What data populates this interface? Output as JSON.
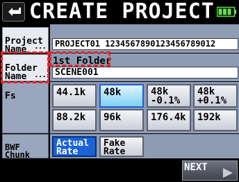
{
  "title": "CREATE PROJECT",
  "icons": {
    "back": "return-arrow-icon",
    "battery": "battery-full-icon",
    "next": "right-arrow-icon"
  },
  "project_name": {
    "label": "Project\nName",
    "dots": "...",
    "value": "PROJECT01 1234567890123456789012"
  },
  "folder_name": {
    "label": "Folder\nName",
    "dots": "...",
    "row_label": "1st Folder",
    "value": "SCENE001"
  },
  "fs": {
    "label": "Fs",
    "options": [
      "44.1k",
      "48k",
      "48k\n-0.1%",
      "48k\n+0.1%",
      "88.2k",
      "96k",
      "176.4k",
      "192k"
    ],
    "selected": "48k"
  },
  "bwf": {
    "label": "BWF\nChunk\nFs",
    "options": [
      "Actual\nRate",
      "Fake\nRate"
    ],
    "selected": "Actual Rate"
  },
  "next_label": "NEXT",
  "colors": {
    "highlight_dash": "#e8232b",
    "selected_blue": "#1a62d6",
    "row_bg": "#8e9bb3"
  }
}
